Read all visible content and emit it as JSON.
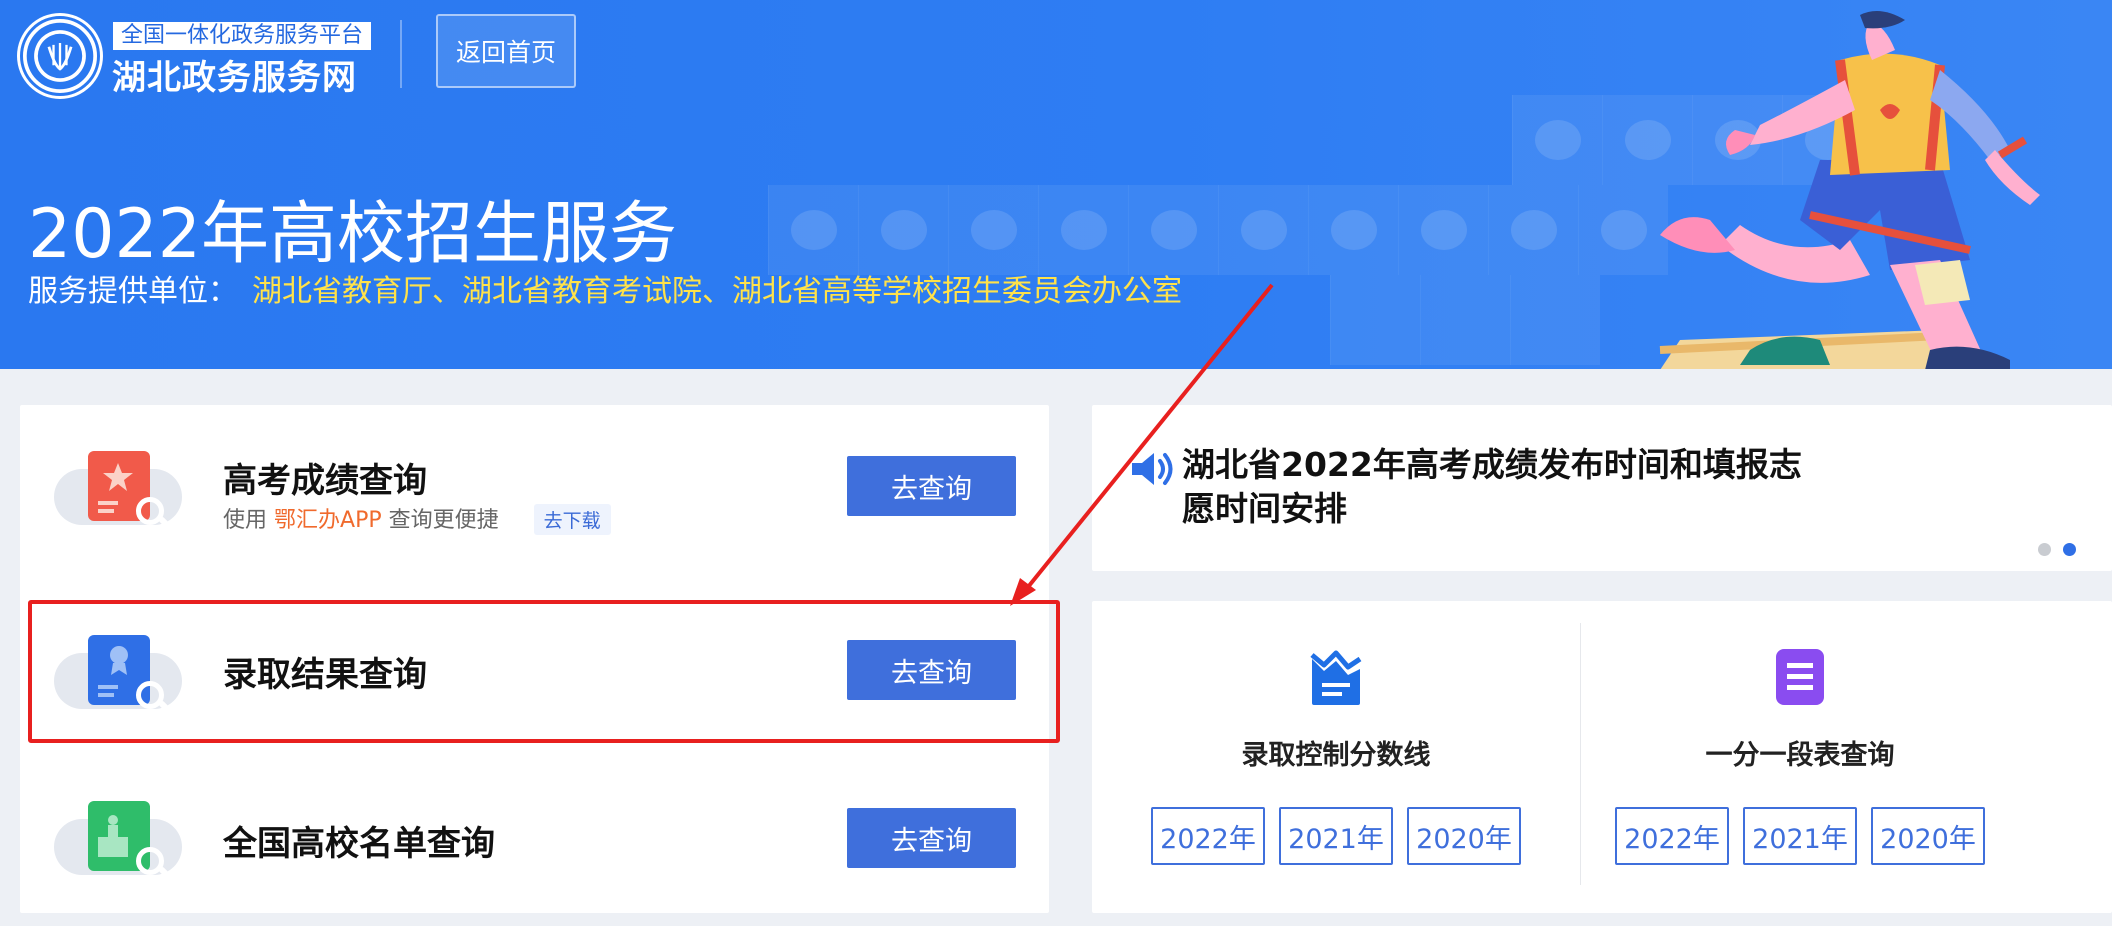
{
  "header": {
    "platform_tag": "全国一体化政务服务平台",
    "site_name": "湖北政务服务网",
    "home_button": "返回首页"
  },
  "banner": {
    "title": "2022年高校招生服务",
    "provider_label": "服务提供单位：",
    "provider_value": "湖北省教育厅、湖北省教育考试院、湖北省高等学校招生委员会办公室"
  },
  "services": [
    {
      "title": "高考成绩查询",
      "sub_prefix": "使用",
      "sub_app": "鄂汇办APP",
      "sub_suffix": "查询更便捷",
      "download_label": "去下载",
      "button": "去查询"
    },
    {
      "title": "录取结果查询",
      "button": "去查询"
    },
    {
      "title": "全国高校名单查询",
      "button": "去查询"
    }
  ],
  "notice": {
    "line1": "湖北省2022年高考成绩发布时间和填报志",
    "line2": "愿时间安排"
  },
  "score_lines": {
    "title": "录取控制分数线",
    "years": [
      "2022年",
      "2021年",
      "2020年"
    ]
  },
  "score_table": {
    "title": "一分一段表查询",
    "years": [
      "2022年",
      "2021年",
      "2020年"
    ]
  },
  "colors": {
    "banner_blue": "#2a78f0",
    "button_blue": "#3f6fdc",
    "provider_yellow": "#ffe24a",
    "app_orange": "#f06a2d",
    "highlight_red": "#e8201f",
    "score_icon_blue": "#1f6fe5",
    "score_icon_purple": "#8a4cf0"
  }
}
